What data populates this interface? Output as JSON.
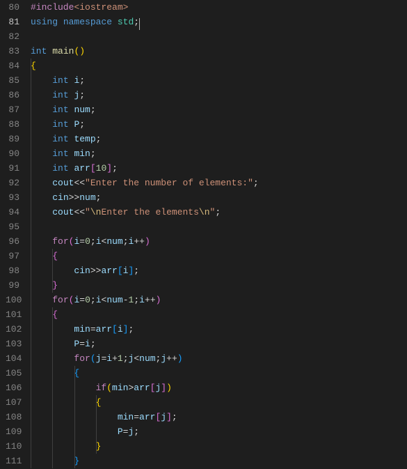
{
  "editor": {
    "active_line": 81,
    "lines": [
      {
        "num": 80,
        "tokens": [
          {
            "t": "#include",
            "c": "ctrl"
          },
          {
            "t": "<iostream>",
            "c": "str"
          }
        ],
        "indent": 0
      },
      {
        "num": 81,
        "tokens": [
          {
            "t": "using",
            "c": "kw"
          },
          {
            "t": " ",
            "c": "punc"
          },
          {
            "t": "namespace",
            "c": "kw"
          },
          {
            "t": " ",
            "c": "punc"
          },
          {
            "t": "std",
            "c": "type"
          },
          {
            "t": ";",
            "c": "punc"
          },
          {
            "t": "",
            "c": "cursor"
          }
        ],
        "indent": 0,
        "active": true
      },
      {
        "num": 82,
        "tokens": [],
        "indent": 0
      },
      {
        "num": 83,
        "tokens": [
          {
            "t": "int",
            "c": "kw"
          },
          {
            "t": " ",
            "c": "punc"
          },
          {
            "t": "main",
            "c": "func"
          },
          {
            "t": "(",
            "c": "brace3"
          },
          {
            "t": ")",
            "c": "brace3"
          }
        ],
        "indent": 0
      },
      {
        "num": 84,
        "tokens": [
          {
            "t": "{",
            "c": "brace3"
          }
        ],
        "indent": 0
      },
      {
        "num": 85,
        "tokens": [
          {
            "t": "    ",
            "c": "punc"
          },
          {
            "t": "int",
            "c": "kw"
          },
          {
            "t": " ",
            "c": "punc"
          },
          {
            "t": "i",
            "c": "var"
          },
          {
            "t": ";",
            "c": "punc"
          }
        ],
        "indent": 1
      },
      {
        "num": 86,
        "tokens": [
          {
            "t": "    ",
            "c": "punc"
          },
          {
            "t": "int",
            "c": "kw"
          },
          {
            "t": " ",
            "c": "punc"
          },
          {
            "t": "j",
            "c": "var"
          },
          {
            "t": ";",
            "c": "punc"
          }
        ],
        "indent": 1
      },
      {
        "num": 87,
        "tokens": [
          {
            "t": "    ",
            "c": "punc"
          },
          {
            "t": "int",
            "c": "kw"
          },
          {
            "t": " ",
            "c": "punc"
          },
          {
            "t": "num",
            "c": "var"
          },
          {
            "t": ";",
            "c": "punc"
          }
        ],
        "indent": 1
      },
      {
        "num": 88,
        "tokens": [
          {
            "t": "    ",
            "c": "punc"
          },
          {
            "t": "int",
            "c": "kw"
          },
          {
            "t": " ",
            "c": "punc"
          },
          {
            "t": "P",
            "c": "var"
          },
          {
            "t": ";",
            "c": "punc"
          }
        ],
        "indent": 1
      },
      {
        "num": 89,
        "tokens": [
          {
            "t": "    ",
            "c": "punc"
          },
          {
            "t": "int",
            "c": "kw"
          },
          {
            "t": " ",
            "c": "punc"
          },
          {
            "t": "temp",
            "c": "var"
          },
          {
            "t": ";",
            "c": "punc"
          }
        ],
        "indent": 1
      },
      {
        "num": 90,
        "tokens": [
          {
            "t": "    ",
            "c": "punc"
          },
          {
            "t": "int",
            "c": "kw"
          },
          {
            "t": " ",
            "c": "punc"
          },
          {
            "t": "min",
            "c": "var"
          },
          {
            "t": ";",
            "c": "punc"
          }
        ],
        "indent": 1
      },
      {
        "num": 91,
        "tokens": [
          {
            "t": "    ",
            "c": "punc"
          },
          {
            "t": "int",
            "c": "kw"
          },
          {
            "t": " ",
            "c": "punc"
          },
          {
            "t": "arr",
            "c": "var"
          },
          {
            "t": "[",
            "c": "brace"
          },
          {
            "t": "10",
            "c": "num"
          },
          {
            "t": "]",
            "c": "brace"
          },
          {
            "t": ";",
            "c": "punc"
          }
        ],
        "indent": 1
      },
      {
        "num": 92,
        "tokens": [
          {
            "t": "    ",
            "c": "punc"
          },
          {
            "t": "cout",
            "c": "var"
          },
          {
            "t": "<<",
            "c": "op"
          },
          {
            "t": "\"Enter the number of elements:\"",
            "c": "str"
          },
          {
            "t": ";",
            "c": "punc"
          }
        ],
        "indent": 1
      },
      {
        "num": 93,
        "tokens": [
          {
            "t": "    ",
            "c": "punc"
          },
          {
            "t": "cin",
            "c": "var"
          },
          {
            "t": ">>",
            "c": "op"
          },
          {
            "t": "num",
            "c": "var"
          },
          {
            "t": ";",
            "c": "punc"
          }
        ],
        "indent": 1
      },
      {
        "num": 94,
        "tokens": [
          {
            "t": "    ",
            "c": "punc"
          },
          {
            "t": "cout",
            "c": "var"
          },
          {
            "t": "<<",
            "c": "op"
          },
          {
            "t": "\"",
            "c": "str"
          },
          {
            "t": "\\n",
            "c": "esc"
          },
          {
            "t": "Enter the elements",
            "c": "str"
          },
          {
            "t": "\\n",
            "c": "esc"
          },
          {
            "t": "\"",
            "c": "str"
          },
          {
            "t": ";",
            "c": "punc"
          }
        ],
        "indent": 1
      },
      {
        "num": 95,
        "tokens": [],
        "indent": 1
      },
      {
        "num": 96,
        "tokens": [
          {
            "t": "    ",
            "c": "punc"
          },
          {
            "t": "for",
            "c": "ctrl"
          },
          {
            "t": "(",
            "c": "brace"
          },
          {
            "t": "i",
            "c": "var"
          },
          {
            "t": "=",
            "c": "op"
          },
          {
            "t": "0",
            "c": "num"
          },
          {
            "t": ";",
            "c": "punc"
          },
          {
            "t": "i",
            "c": "var"
          },
          {
            "t": "<",
            "c": "op"
          },
          {
            "t": "num",
            "c": "var"
          },
          {
            "t": ";",
            "c": "punc"
          },
          {
            "t": "i",
            "c": "var"
          },
          {
            "t": "++",
            "c": "op"
          },
          {
            "t": ")",
            "c": "brace"
          }
        ],
        "indent": 1
      },
      {
        "num": 97,
        "tokens": [
          {
            "t": "    ",
            "c": "punc"
          },
          {
            "t": "{",
            "c": "brace"
          }
        ],
        "indent": 1
      },
      {
        "num": 98,
        "tokens": [
          {
            "t": "        ",
            "c": "punc"
          },
          {
            "t": "cin",
            "c": "var"
          },
          {
            "t": ">>",
            "c": "op"
          },
          {
            "t": "arr",
            "c": "var"
          },
          {
            "t": "[",
            "c": "brace2"
          },
          {
            "t": "i",
            "c": "var"
          },
          {
            "t": "]",
            "c": "brace2"
          },
          {
            "t": ";",
            "c": "punc"
          }
        ],
        "indent": 2
      },
      {
        "num": 99,
        "tokens": [
          {
            "t": "    ",
            "c": "punc"
          },
          {
            "t": "}",
            "c": "brace"
          }
        ],
        "indent": 1
      },
      {
        "num": 100,
        "tokens": [
          {
            "t": "    ",
            "c": "punc"
          },
          {
            "t": "for",
            "c": "ctrl"
          },
          {
            "t": "(",
            "c": "brace"
          },
          {
            "t": "i",
            "c": "var"
          },
          {
            "t": "=",
            "c": "op"
          },
          {
            "t": "0",
            "c": "num"
          },
          {
            "t": ";",
            "c": "punc"
          },
          {
            "t": "i",
            "c": "var"
          },
          {
            "t": "<",
            "c": "op"
          },
          {
            "t": "num",
            "c": "var"
          },
          {
            "t": "-",
            "c": "op"
          },
          {
            "t": "1",
            "c": "num"
          },
          {
            "t": ";",
            "c": "punc"
          },
          {
            "t": "i",
            "c": "var"
          },
          {
            "t": "++",
            "c": "op"
          },
          {
            "t": ")",
            "c": "brace"
          }
        ],
        "indent": 1
      },
      {
        "num": 101,
        "tokens": [
          {
            "t": "    ",
            "c": "punc"
          },
          {
            "t": "{",
            "c": "brace"
          }
        ],
        "indent": 1
      },
      {
        "num": 102,
        "tokens": [
          {
            "t": "        ",
            "c": "punc"
          },
          {
            "t": "min",
            "c": "var"
          },
          {
            "t": "=",
            "c": "op"
          },
          {
            "t": "arr",
            "c": "var"
          },
          {
            "t": "[",
            "c": "brace2"
          },
          {
            "t": "i",
            "c": "var"
          },
          {
            "t": "]",
            "c": "brace2"
          },
          {
            "t": ";",
            "c": "punc"
          }
        ],
        "indent": 2
      },
      {
        "num": 103,
        "tokens": [
          {
            "t": "        ",
            "c": "punc"
          },
          {
            "t": "P",
            "c": "var"
          },
          {
            "t": "=",
            "c": "op"
          },
          {
            "t": "i",
            "c": "var"
          },
          {
            "t": ";",
            "c": "punc"
          }
        ],
        "indent": 2
      },
      {
        "num": 104,
        "tokens": [
          {
            "t": "        ",
            "c": "punc"
          },
          {
            "t": "for",
            "c": "ctrl"
          },
          {
            "t": "(",
            "c": "brace2"
          },
          {
            "t": "j",
            "c": "var"
          },
          {
            "t": "=",
            "c": "op"
          },
          {
            "t": "i",
            "c": "var"
          },
          {
            "t": "+",
            "c": "op"
          },
          {
            "t": "1",
            "c": "num"
          },
          {
            "t": ";",
            "c": "punc"
          },
          {
            "t": "j",
            "c": "var"
          },
          {
            "t": "<",
            "c": "op"
          },
          {
            "t": "num",
            "c": "var"
          },
          {
            "t": ";",
            "c": "punc"
          },
          {
            "t": "j",
            "c": "var"
          },
          {
            "t": "++",
            "c": "op"
          },
          {
            "t": ")",
            "c": "brace2"
          }
        ],
        "indent": 2
      },
      {
        "num": 105,
        "tokens": [
          {
            "t": "        ",
            "c": "punc"
          },
          {
            "t": "{",
            "c": "brace2"
          }
        ],
        "indent": 2
      },
      {
        "num": 106,
        "tokens": [
          {
            "t": "            ",
            "c": "punc"
          },
          {
            "t": "if",
            "c": "ctrl"
          },
          {
            "t": "(",
            "c": "brace3"
          },
          {
            "t": "min",
            "c": "var"
          },
          {
            "t": ">",
            "c": "op"
          },
          {
            "t": "arr",
            "c": "var"
          },
          {
            "t": "[",
            "c": "brace"
          },
          {
            "t": "j",
            "c": "var"
          },
          {
            "t": "]",
            "c": "brace"
          },
          {
            "t": ")",
            "c": "brace3"
          }
        ],
        "indent": 3
      },
      {
        "num": 107,
        "tokens": [
          {
            "t": "            ",
            "c": "punc"
          },
          {
            "t": "{",
            "c": "brace3"
          }
        ],
        "indent": 3
      },
      {
        "num": 108,
        "tokens": [
          {
            "t": "                ",
            "c": "punc"
          },
          {
            "t": "min",
            "c": "var"
          },
          {
            "t": "=",
            "c": "op"
          },
          {
            "t": "arr",
            "c": "var"
          },
          {
            "t": "[",
            "c": "brace"
          },
          {
            "t": "j",
            "c": "var"
          },
          {
            "t": "]",
            "c": "brace"
          },
          {
            "t": ";",
            "c": "punc"
          }
        ],
        "indent": 4
      },
      {
        "num": 109,
        "tokens": [
          {
            "t": "                ",
            "c": "punc"
          },
          {
            "t": "P",
            "c": "var"
          },
          {
            "t": "=",
            "c": "op"
          },
          {
            "t": "j",
            "c": "var"
          },
          {
            "t": ";",
            "c": "punc"
          }
        ],
        "indent": 4
      },
      {
        "num": 110,
        "tokens": [
          {
            "t": "            ",
            "c": "punc"
          },
          {
            "t": "}",
            "c": "brace3"
          }
        ],
        "indent": 3
      },
      {
        "num": 111,
        "tokens": [
          {
            "t": "        ",
            "c": "punc"
          },
          {
            "t": "}",
            "c": "brace2"
          }
        ],
        "indent": 2
      }
    ]
  }
}
